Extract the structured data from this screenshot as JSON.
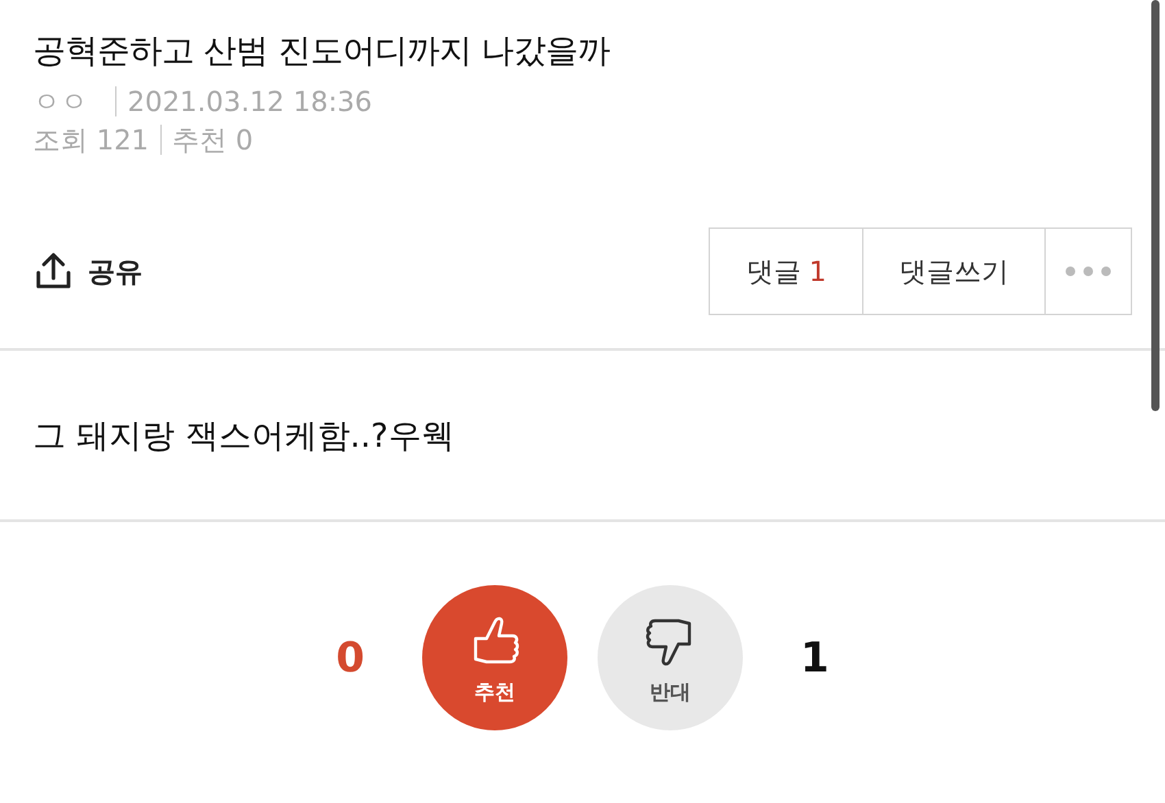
{
  "post": {
    "title": "공혁준하고 산범 진도어디까지 나갔을까",
    "author": "ㅇㅇ",
    "date": "2021.03.12 18:36",
    "views": "조회 121",
    "recommends": "추천 0"
  },
  "actions": {
    "share": "공유",
    "comments_label": "댓글",
    "comments_count": "1",
    "write_comment": "댓글쓰기"
  },
  "body": "그 돼지랑 잭스어케함..?우웩",
  "votes": [
    {
      "kind": "up",
      "label": "추천",
      "count": "0"
    },
    {
      "kind": "down",
      "label": "반대",
      "count": "1"
    }
  ]
}
